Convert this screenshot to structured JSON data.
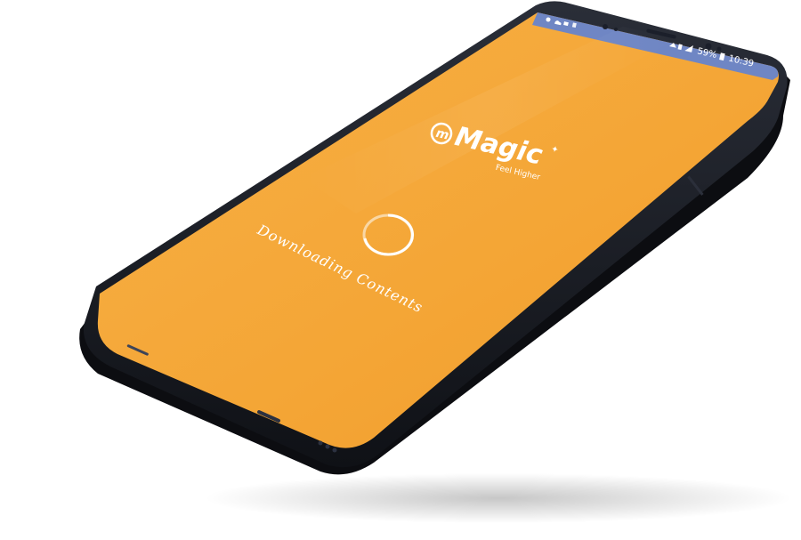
{
  "status_bar": {
    "battery_percent": "59%",
    "time": "10:39",
    "icons": [
      "settings-icon",
      "cloud-icon",
      "notification-icon",
      "wifi-icon",
      "sim-icon",
      "signal-icon",
      "battery-icon"
    ]
  },
  "splash": {
    "brand_name": "Magic",
    "brand_mark": "m",
    "tagline": "Feel Higher",
    "loading_label": "Downloading Contents"
  },
  "theme": {
    "screen_color": "#F5A83A",
    "phone_body_color": "#1a1d24",
    "status_bar_color": "#6f86c4"
  }
}
